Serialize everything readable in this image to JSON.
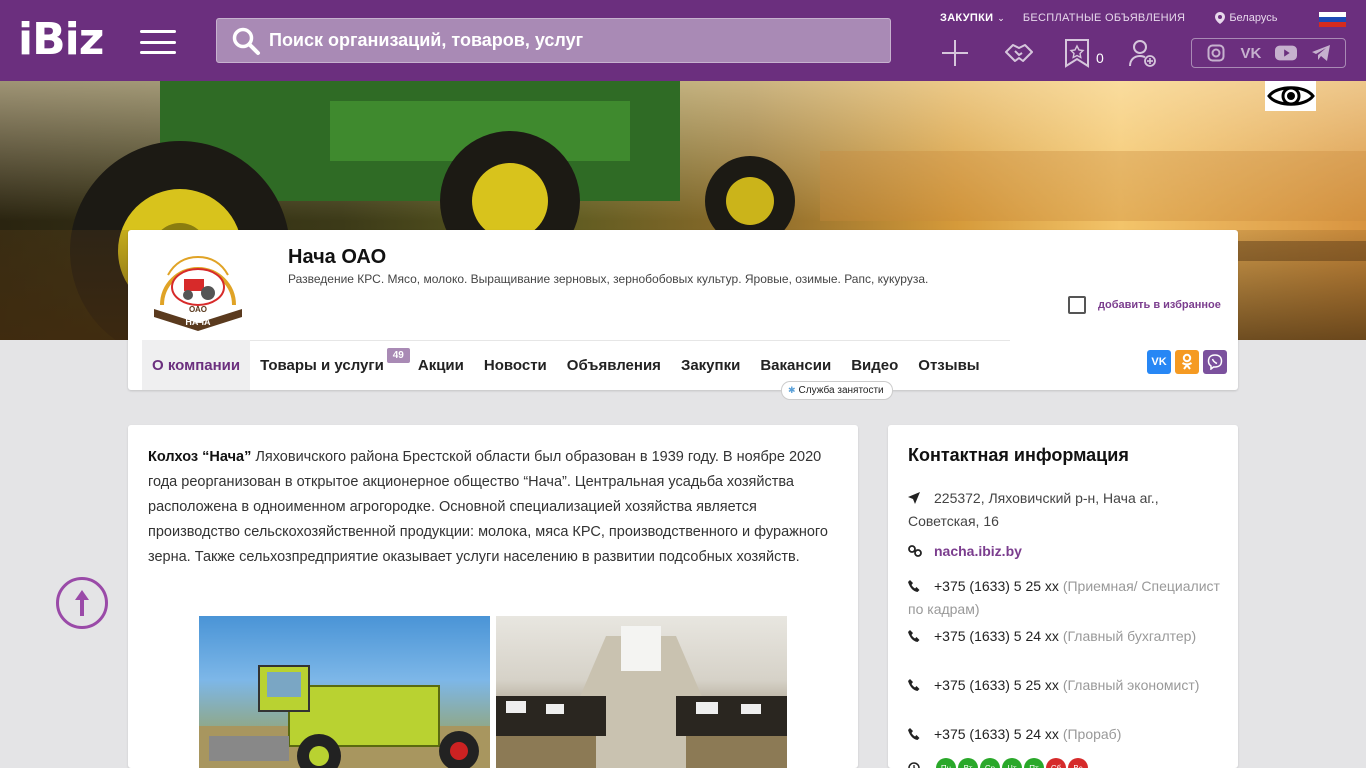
{
  "header": {
    "logo": "iBiz",
    "search_placeholder": "Поиск организаций, товаров, услуг",
    "links": {
      "procurements": "ЗАКУПКИ",
      "free_ads": "БЕСПЛАТНЫЕ ОБЪЯВЛЕНИЯ",
      "location": "Беларусь"
    },
    "favorites_count": "0",
    "colors": {
      "brand": "#6b2f7e",
      "accent": "#7b3d8e"
    }
  },
  "company": {
    "name": "Нача ОАО",
    "description": "Разведение КРС. Мясо, молоко. Выращивание зерновых, зернобобовых культур. Яровые, озимые. Рапс, кукуруза.",
    "add_favorite": "добавить в избранное",
    "logo_text_top": "ОАО",
    "logo_text_bottom": "НАЧА"
  },
  "tabs": [
    {
      "label": "О компании",
      "active": true
    },
    {
      "label": "Товары и услуги",
      "badge": "49"
    },
    {
      "label": "Акции"
    },
    {
      "label": "Новости"
    },
    {
      "label": "Объявления"
    },
    {
      "label": "Закупки"
    },
    {
      "label": "Вакансии"
    },
    {
      "label": "Видео"
    },
    {
      "label": "Отзывы"
    }
  ],
  "tooltip": "Служба занятости",
  "article": {
    "lead": "Колхоз “Нача”",
    "text": " Ляховичского района Брестской области был образован в 1939 году. В ноябре 2020 года реорганизован в открытое акционерное общество “Нача”. Центральная усадьба хозяйства расположена в одноименном агрогородке. Основной специализацией хозяйства является производство сельскохозяйственной продукции: молока, мяса КРС, производственного и фуражного зерна. Также сельхозпредприятие оказывает услуги населению в развитии подсобных хозяйств."
  },
  "contacts": {
    "title": "Контактная информация",
    "address": "225372, Ляховичский р-н, Нача аг., Советская, 16",
    "site": "nacha.ibiz.by",
    "phones": [
      {
        "number": "+375 (1633) 5 25 xx",
        "note": "(Приемная/ Специалист по кадрам)"
      },
      {
        "number": "+375 (1633) 5 24 xx",
        "note": "(Главный бухгалтер)"
      },
      {
        "number": "+375 (1633) 5 25 xx",
        "note": "(Главный экономист)"
      },
      {
        "number": "+375 (1633) 5 24 xx",
        "note": "(Прораб)"
      }
    ],
    "days": [
      "Пн",
      "Вт",
      "Ср",
      "Чт",
      "Пт",
      "Сб",
      "Вс"
    ]
  }
}
